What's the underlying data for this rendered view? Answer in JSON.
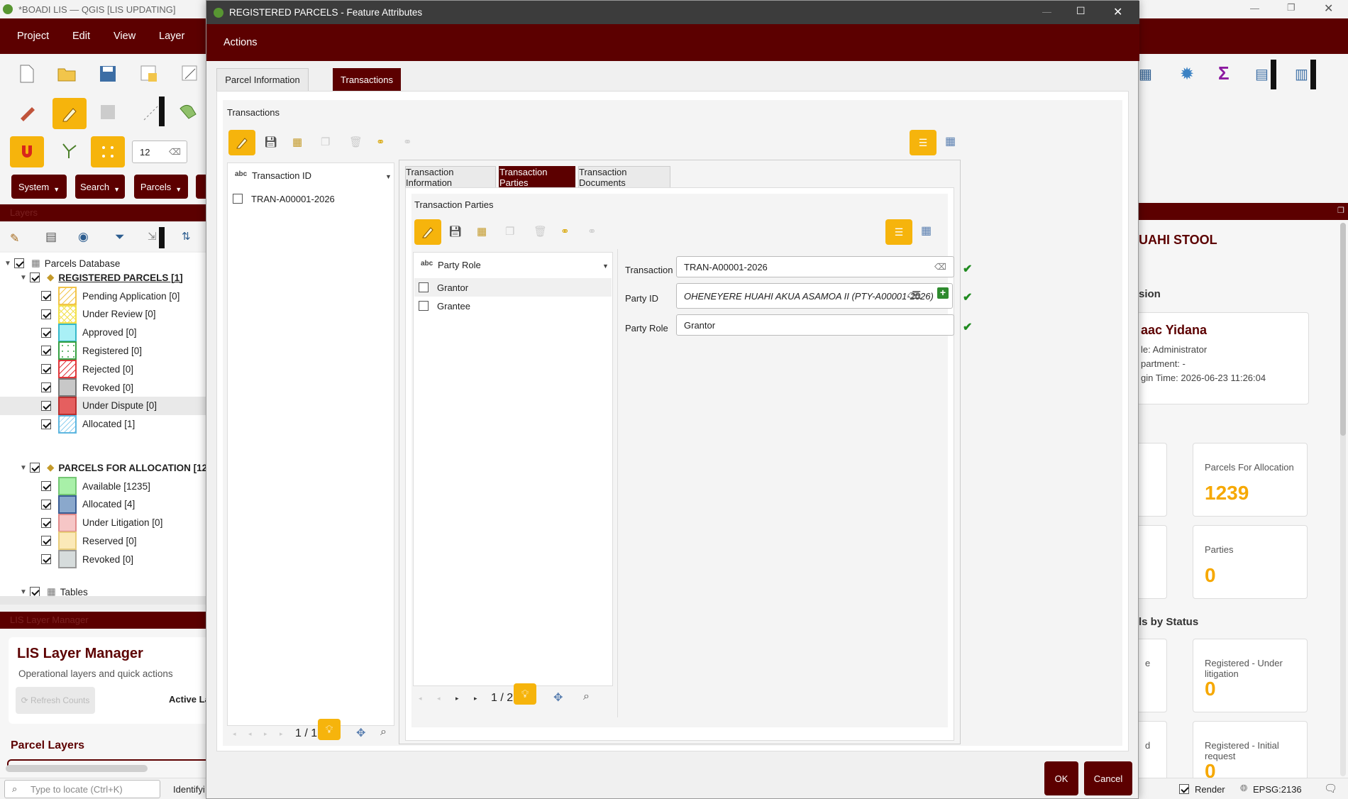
{
  "main_window": {
    "title": "*BOADI LIS — QGIS [LIS UPDATING]",
    "menu": [
      "Project",
      "Edit",
      "View",
      "Layer"
    ],
    "scale_value": "12",
    "plugin_buttons": [
      "System",
      "Search",
      "Parcels"
    ]
  },
  "layers_panel": {
    "title": "Layers",
    "group1": "Parcels Database",
    "registered_group": "REGISTERED PARCELS [1]",
    "registered_items": [
      {
        "label": "Pending Application [0]"
      },
      {
        "label": "Under Review [0]"
      },
      {
        "label": "Approved [0]"
      },
      {
        "label": "Registered [0]"
      },
      {
        "label": "Rejected [0]"
      },
      {
        "label": "Revoked [0]"
      },
      {
        "label": "Under Dispute [0]"
      },
      {
        "label": "Allocated [1]"
      }
    ],
    "allocation_group": "PARCELS FOR ALLOCATION [12",
    "allocation_items": [
      {
        "label": "Available [1235]"
      },
      {
        "label": "Allocated [4]"
      },
      {
        "label": "Under Litigation [0]"
      },
      {
        "label": "Reserved [0]"
      },
      {
        "label": "Revoked [0]"
      }
    ],
    "tables_group": "Tables"
  },
  "lis_manager": {
    "panel_title": "LIS Layer Manager",
    "title": "LIS Layer Manager",
    "subtitle": "Operational layers and quick actions",
    "refresh_button": "⟳ Refresh Counts",
    "active_label": "Active La",
    "parcel_layers_heading": "Parcel Layers"
  },
  "statusbar": {
    "locate_placeholder": "Type to locate (Ctrl+K)",
    "identify": "Identifyi",
    "render_label": "Render",
    "crs": "EPSG:2136"
  },
  "dashboard": {
    "stool": "UAHI STOOL",
    "section": "sion",
    "user_name": "aac Yidana",
    "role": "le: Administrator",
    "department": "partment: -",
    "login": "gin Time: 2026-06-23 11:26:04",
    "status_heading": "ls by Status",
    "cards": [
      {
        "label": "Parcels For Allocation",
        "value": "1239"
      },
      {
        "label": "Parties",
        "value": "0"
      },
      {
        "label": "Registered - Under litigation",
        "value": "0"
      },
      {
        "label": "Registered - Initial request",
        "value": "0"
      }
    ],
    "left_partial_labels": [
      "e",
      "d"
    ]
  },
  "dialog": {
    "title": "REGISTERED PARCELS - Feature Attributes",
    "actions_label": "Actions",
    "tabs": [
      "Parcel Information",
      "Transactions"
    ],
    "transactions_group": "Transactions",
    "list_header": "Transaction ID",
    "list_items": [
      "TRAN-A00001-2026"
    ],
    "list_nav": "1 / 1",
    "inner_tabs": [
      "Transaction Information",
      "Transaction Parties",
      "Transaction Documents"
    ],
    "parties_group": "Transaction Parties",
    "parties_list_header": "Party Role",
    "parties_items": [
      "Grantor",
      "Grantee"
    ],
    "parties_nav": "1 / 2",
    "form": {
      "transaction_id_label": "Transaction ID",
      "transaction_id_value": "TRAN-A00001-2026",
      "party_id_label": "Party ID",
      "party_id_value": "OHENEYERE HUAHI AKUA ASAMOA II (PTY-A00001-2026)",
      "party_role_label": "Party Role",
      "party_role_value": "Grantor"
    },
    "ok_button": "OK",
    "cancel_button": "Cancel"
  },
  "colors": {
    "maroon": "#5c0000",
    "accent": "#f6b40c",
    "valid": "#1f8a1f"
  }
}
